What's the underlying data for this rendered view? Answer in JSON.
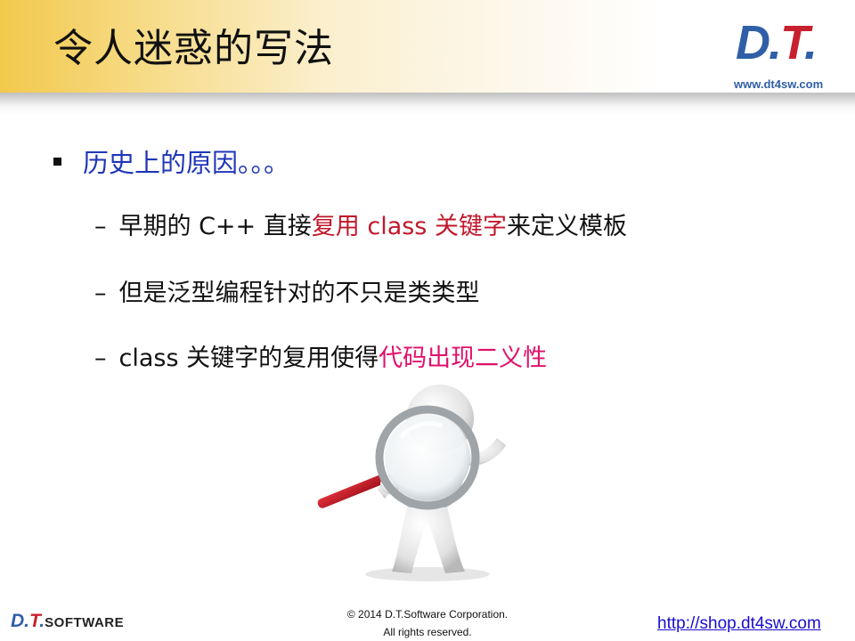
{
  "header": {
    "title": "令人迷惑的写法",
    "logo_d": "D",
    "logo_dot1": ".",
    "logo_t": "T",
    "logo_dot2": ".",
    "logo_url": "www.dt4sw.com"
  },
  "main_bullet": "历史上的原因。。。",
  "sub_bullets": [
    {
      "dash": "–",
      "before": "早期的 C++ 直接",
      "highlight": "复用 class 关键字",
      "after": "来定义模板"
    },
    {
      "dash": "–",
      "text": "但是泛型编程针对的不只是类类型"
    },
    {
      "dash": "–",
      "before": "class 关键字的复用使得",
      "highlight": "代码出现二义性"
    }
  ],
  "footer": {
    "logo_d": "D",
    "logo_dot1": ".",
    "logo_t": "T",
    "logo_dot2": ".",
    "logo_software": "SOFTWARE",
    "copyright_line1": "© 2014 D.T.Software Corporation.",
    "copyright_line2": "All rights reserved.",
    "shop_link": "http://shop.dt4sw.com"
  },
  "colors": {
    "accent_blue": "#1f36b7",
    "highlight_red": "#c0192c",
    "highlight_pink": "#e0106a",
    "header_gold": "#f2c94c"
  }
}
